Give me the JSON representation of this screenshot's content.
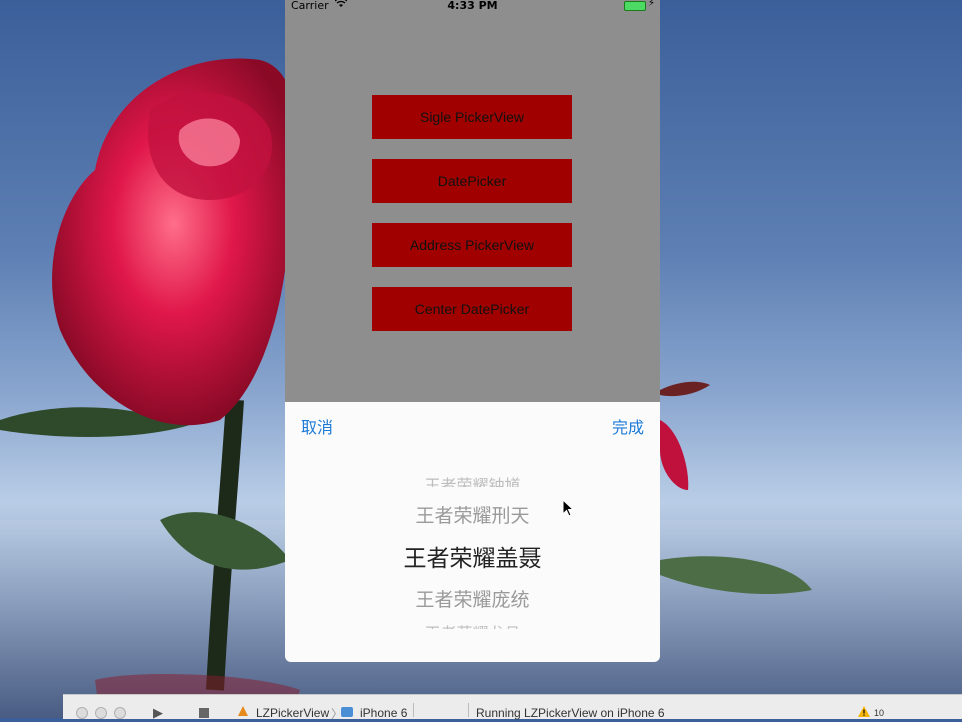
{
  "statusbar": {
    "carrier": "Carrier",
    "time": "4:33 PM"
  },
  "buttons": [
    {
      "label": "Sigle PickerView"
    },
    {
      "label": "DatePicker"
    },
    {
      "label": "Address PickerView"
    },
    {
      "label": "Center DatePicker"
    }
  ],
  "sheet": {
    "cancel_label": "取消",
    "done_label": "完成"
  },
  "picker": {
    "rows": [
      {
        "label": "王者荣耀钟馗"
      },
      {
        "label": "王者荣耀刑天"
      },
      {
        "label": "王者荣耀盖聂",
        "selected": true
      },
      {
        "label": "王者荣耀庞统"
      },
      {
        "label": "王者荣耀龙且"
      }
    ]
  },
  "debugbar": {
    "scheme": "LZPickerView",
    "device": "iPhone 6",
    "status": "Running LZPickerView on iPhone 6",
    "warning_count": "10"
  },
  "colors": {
    "button_bg": "#a10000",
    "tint": "#1b7ad8",
    "dim_overlay": "#8e8e8e"
  }
}
